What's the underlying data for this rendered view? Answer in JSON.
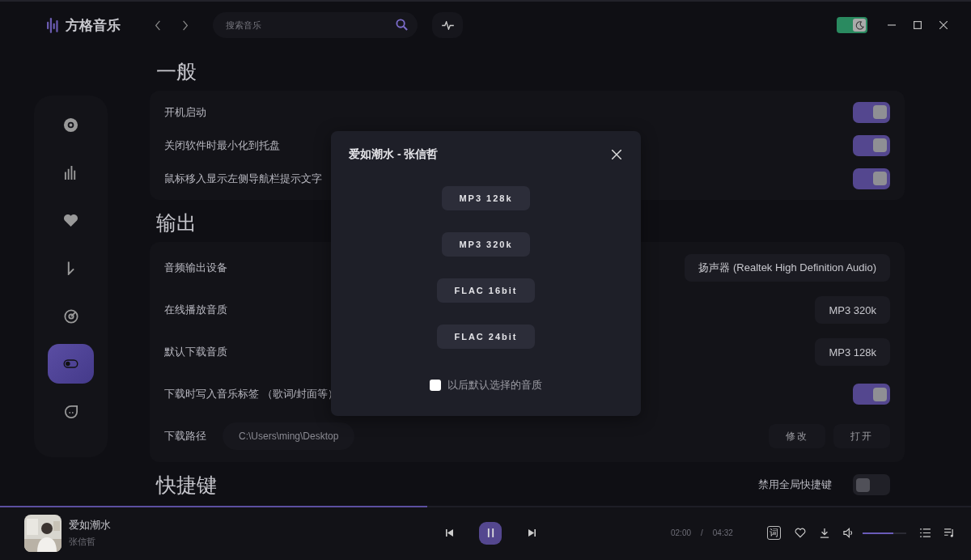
{
  "app": {
    "name": "方格音乐"
  },
  "search": {
    "placeholder": "搜索音乐"
  },
  "theme_toggle": {
    "on": true
  },
  "sidebar": {
    "items": [
      {
        "kind": "disc",
        "selected": false
      },
      {
        "kind": "bars",
        "selected": false
      },
      {
        "kind": "heart",
        "selected": false
      },
      {
        "kind": "arrow",
        "selected": false
      },
      {
        "kind": "radar",
        "selected": false
      },
      {
        "kind": "switch",
        "selected": true
      },
      {
        "kind": "chat",
        "selected": false
      }
    ]
  },
  "sections": [
    {
      "title": "一般",
      "rows": [
        {
          "kind": "toggle",
          "label": "开机启动",
          "on": true
        },
        {
          "kind": "toggle",
          "label": "关闭软件时最小化到托盘",
          "on": true
        },
        {
          "kind": "toggle",
          "label": "鼠标移入显示左侧导航栏提示文字",
          "on": true
        }
      ]
    },
    {
      "title": "输出",
      "rows": [
        {
          "kind": "select",
          "label": "音频输出设备",
          "value": "扬声器 (Realtek High Definition Audio)"
        },
        {
          "kind": "select",
          "label": "在线播放音质",
          "value": "MP3 320k"
        },
        {
          "kind": "select",
          "label": "默认下载音质",
          "value": "MP3 128k"
        },
        {
          "kind": "toggle",
          "label": "下载时写入音乐标签 （歌词/封面等）",
          "on": true
        },
        {
          "kind": "path",
          "label": "下载路径",
          "value": "C:\\Users\\ming\\Desktop",
          "buttons": [
            "修改",
            "打开"
          ]
        }
      ]
    },
    {
      "title": "快捷键",
      "header_toggle": {
        "label": "禁用全局快捷键",
        "on": false
      }
    }
  ],
  "dialog": {
    "title": "爱如潮水 - 张信哲",
    "options": [
      "MP3 128k",
      "MP3 320k",
      "FLAC 16bit",
      "FLAC 24bit"
    ],
    "remember": {
      "label": "以后默认选择的音质",
      "checked": false
    }
  },
  "player": {
    "progress": {
      "level": 0.44
    },
    "title": "爱如潮水",
    "artist": "张信哲",
    "playing": true,
    "elapsed": "02:00",
    "separator": "/",
    "duration": "04:32",
    "lyrics_button": "词",
    "volume": {
      "level": 0.7
    }
  }
}
